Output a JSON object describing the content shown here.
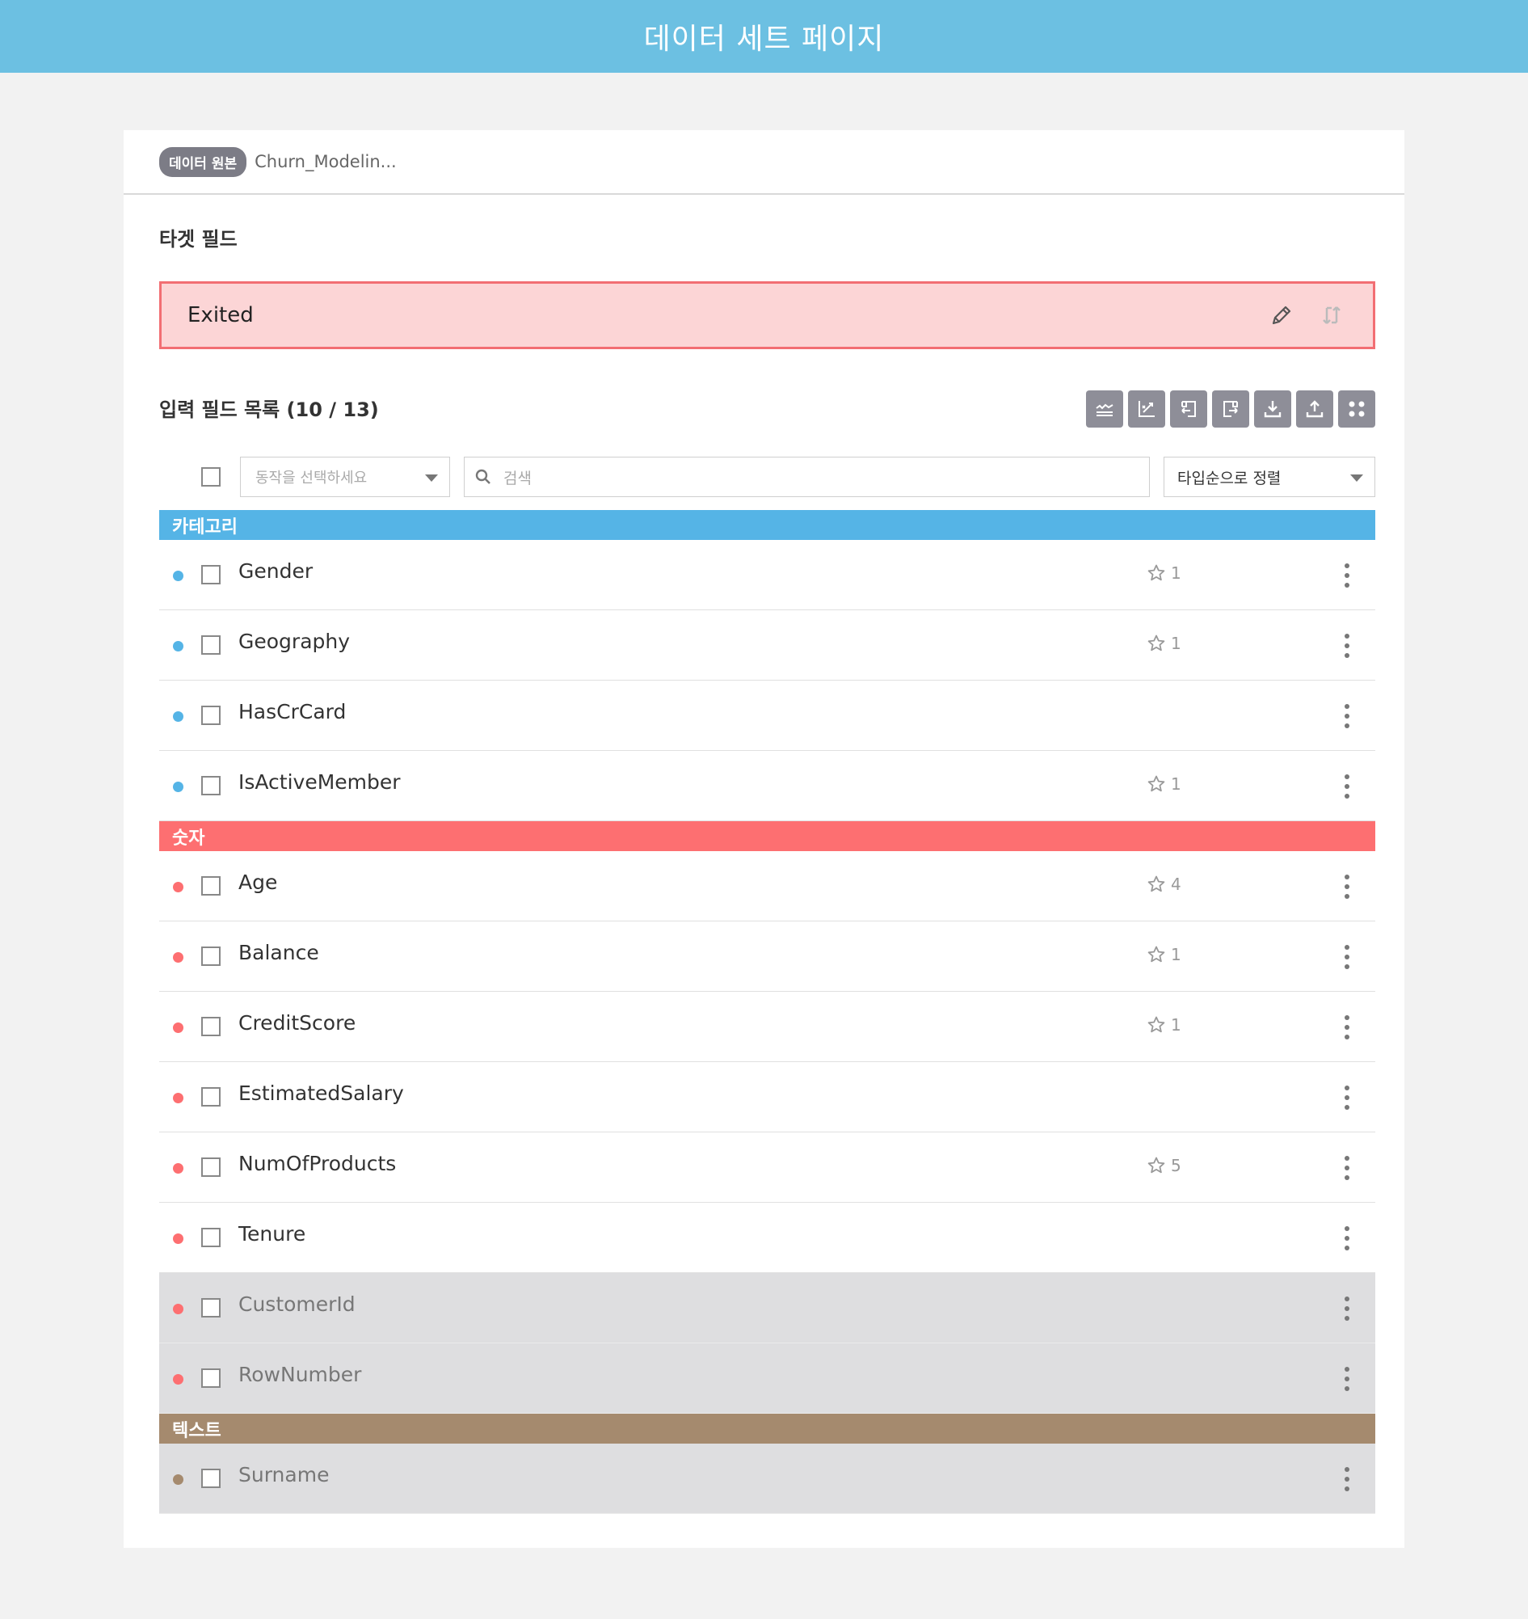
{
  "header": {
    "title": "데이터 세트 페이지"
  },
  "source": {
    "badge": "데이터 원본",
    "name": "Churn_Modelin..."
  },
  "target": {
    "section_title": "타겟 필드",
    "field": "Exited"
  },
  "inputs": {
    "section_title": "입력 필드 목록 (10 / 13)",
    "action_placeholder": "동작을 선택하세요",
    "search_placeholder": "검색",
    "sort_label": "타입순으로 정렬"
  },
  "categories": [
    {
      "label": "카테고리",
      "color": "#55b4e6",
      "fields": [
        {
          "name": "Gender",
          "star": "1",
          "disabled": false
        },
        {
          "name": "Geography",
          "star": "1",
          "disabled": false
        },
        {
          "name": "HasCrCard",
          "star": "",
          "disabled": false
        },
        {
          "name": "IsActiveMember",
          "star": "1",
          "disabled": false
        }
      ]
    },
    {
      "label": "숫자",
      "color": "#fd6f71",
      "fields": [
        {
          "name": "Age",
          "star": "4",
          "disabled": false
        },
        {
          "name": "Balance",
          "star": "1",
          "disabled": false
        },
        {
          "name": "CreditScore",
          "star": "1",
          "disabled": false
        },
        {
          "name": "EstimatedSalary",
          "star": "",
          "disabled": false
        },
        {
          "name": "NumOfProducts",
          "star": "5",
          "disabled": false
        },
        {
          "name": "Tenure",
          "star": "",
          "disabled": false
        },
        {
          "name": "CustomerId",
          "star": "",
          "disabled": true
        },
        {
          "name": "RowNumber",
          "star": "",
          "disabled": true
        }
      ]
    },
    {
      "label": "텍스트",
      "color": "#a58a6e",
      "fields": [
        {
          "name": "Surname",
          "star": "",
          "disabled": true
        }
      ]
    }
  ],
  "toolbar_icons": [
    "chart-line-icon",
    "scatter-edit-icon",
    "import-left-icon",
    "import-right-icon",
    "download-icon",
    "upload-icon",
    "grid-dots-icon"
  ]
}
